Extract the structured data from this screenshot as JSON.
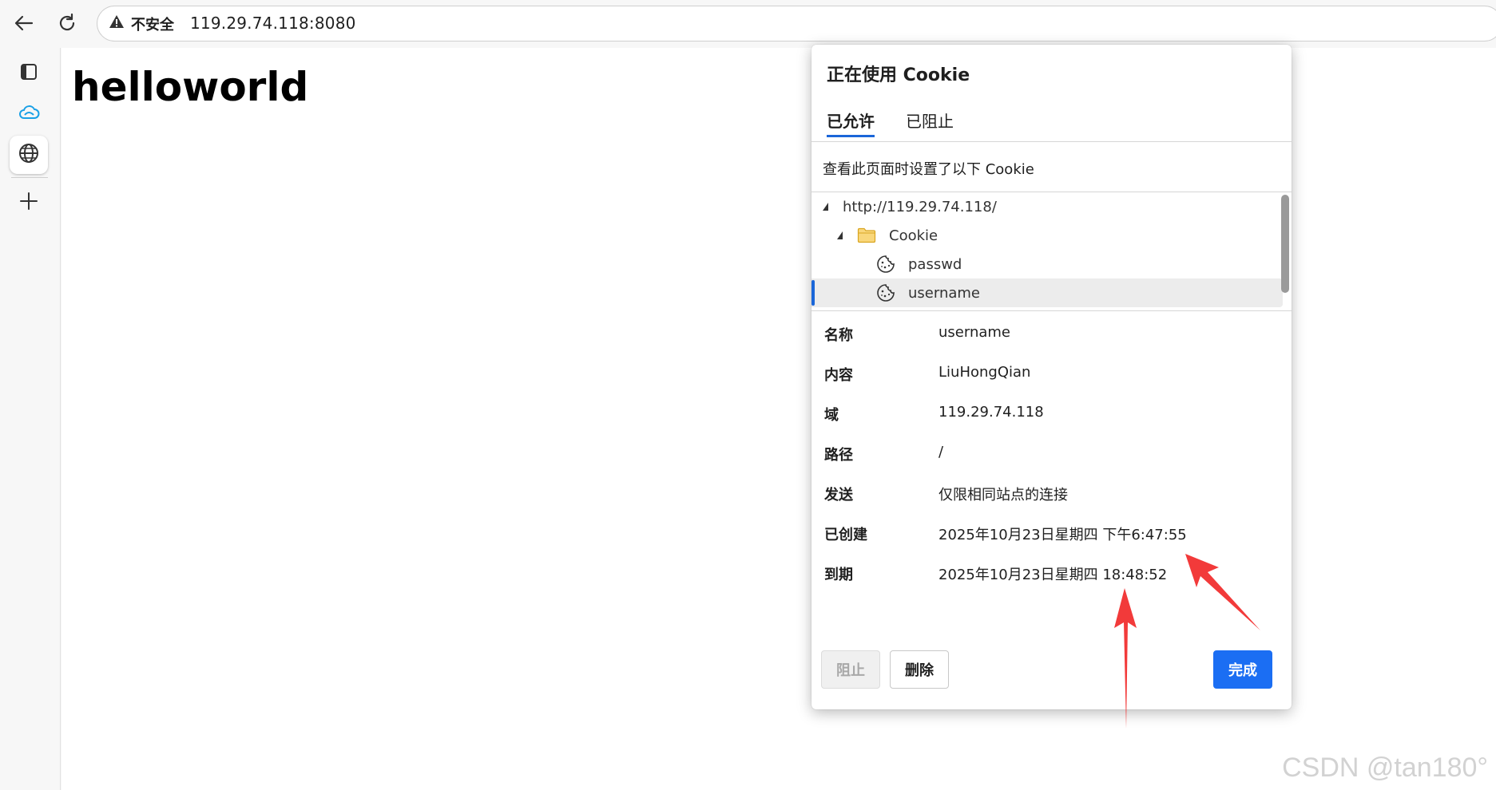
{
  "browser": {
    "security_label": "不安全",
    "url": "119.29.74.118:8080"
  },
  "page": {
    "heading": "helloworld",
    "watermark": "CSDN @tan180°"
  },
  "dialog": {
    "title": "正在使用 Cookie",
    "tabs": [
      {
        "label": "已允许",
        "active": true
      },
      {
        "label": "已阻止",
        "active": false
      }
    ],
    "description": "查看此页面时设置了以下 Cookie",
    "tree": {
      "origin": "http://119.29.74.118/",
      "folder": "Cookie",
      "cookies": [
        "passwd",
        "username"
      ],
      "selected": "username"
    },
    "details": [
      {
        "label": "名称",
        "value": "username"
      },
      {
        "label": "内容",
        "value": "LiuHongQian"
      },
      {
        "label": "域",
        "value": "119.29.74.118"
      },
      {
        "label": "路径",
        "value": "/"
      },
      {
        "label": "发送",
        "value": "仅限相同站点的连接"
      },
      {
        "label": "已创建",
        "value": "2025年10月23日星期四 下午6:47:55"
      },
      {
        "label": "到期",
        "value": "2025年10月23日星期四 18:48:52"
      }
    ],
    "buttons": {
      "block": "阻止",
      "delete": "删除",
      "done": "完成"
    }
  },
  "colors": {
    "accent": "#1b6ef3",
    "annotation_arrow": "#f23a3a"
  },
  "icons": [
    "back-arrow-icon",
    "reload-icon",
    "warning-icon",
    "tabs-icon",
    "cloud-icon",
    "globe-icon",
    "plus-icon",
    "folder-icon",
    "cookie-icon"
  ]
}
